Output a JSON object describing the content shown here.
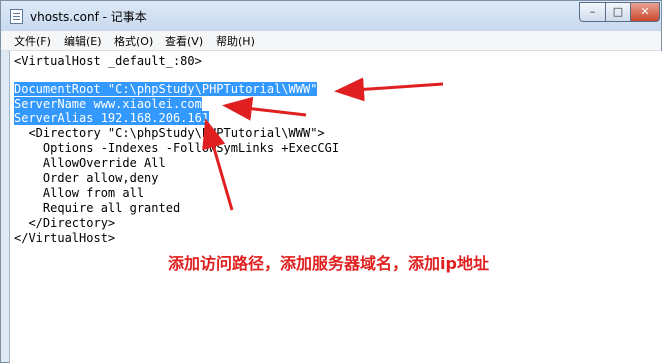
{
  "window": {
    "title": "vhosts.conf - 记事本",
    "controls": {
      "minimize": "–",
      "maximize": "□",
      "close": "✕"
    }
  },
  "menu": [
    "文件(F)",
    "编辑(E)",
    "格式(O)",
    "查看(V)",
    "帮助(H)"
  ],
  "editor": {
    "lines": [
      "<VirtualHost _default_:80>",
      "",
      "DocumentRoot \"C:\\phpStudy\\PHPTutorial\\WWW\"",
      "ServerName www.xiaolei.com",
      "ServerAlias 192.168.206.161",
      "  <Directory \"C:\\phpStudy\\PHPTutorial\\WWW\">",
      "    Options -Indexes -FollowSymLinks +ExecCGI",
      "    AllowOverride All",
      "    Order allow,deny",
      "    Allow from all",
      "    Require all granted",
      "  </Directory>",
      "</VirtualHost>"
    ],
    "selected_lines": [
      2,
      3,
      4
    ]
  },
  "annotation": {
    "text": "添加访问路径，添加服务器域名，添加ip地址",
    "color": "#e02020"
  },
  "colors": {
    "selection": "#3399ff",
    "arrow": "#e02020"
  }
}
